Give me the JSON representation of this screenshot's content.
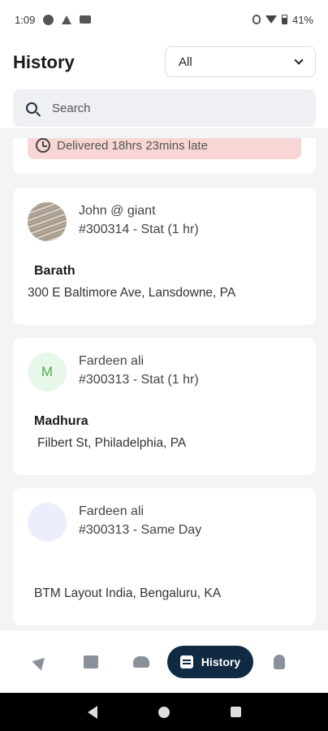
{
  "status_bar": {
    "time": "1:09",
    "battery": "41%"
  },
  "header": {
    "title": "History",
    "filter": {
      "selected": "All"
    },
    "search": {
      "placeholder": "Search"
    }
  },
  "orders": [
    {
      "late_banner": "Delivered 18hrs 23mins late"
    },
    {
      "customer": "John @ giant",
      "order": "#300314 - Stat (1 hr)",
      "recipient": "Barath",
      "address": "300 E Baltimore Ave, Lansdowne, PA",
      "avatar": "photo"
    },
    {
      "customer": "Fardeen ali",
      "order": "#300313 - Stat (1 hr)",
      "recipient": "Madhura",
      "address": "Filbert St, Philadelphia, PA",
      "avatar_letter": "M"
    },
    {
      "customer": "Fardeen ali",
      "order": "#300313 - Same Day",
      "recipient": "",
      "address": "BTM Layout  India, Bengaluru, KA",
      "avatar": "blank"
    }
  ],
  "bottom_nav": {
    "items": [
      {
        "icon": "send-icon"
      },
      {
        "icon": "package-icon"
      },
      {
        "icon": "users-icon"
      },
      {
        "icon": "history-icon",
        "label": "History",
        "active": true
      },
      {
        "icon": "profile-icon"
      }
    ]
  },
  "colors": {
    "accent": "#102a43",
    "late_banner": "#f9d6d6",
    "avatar_letter": "#4caf50"
  }
}
